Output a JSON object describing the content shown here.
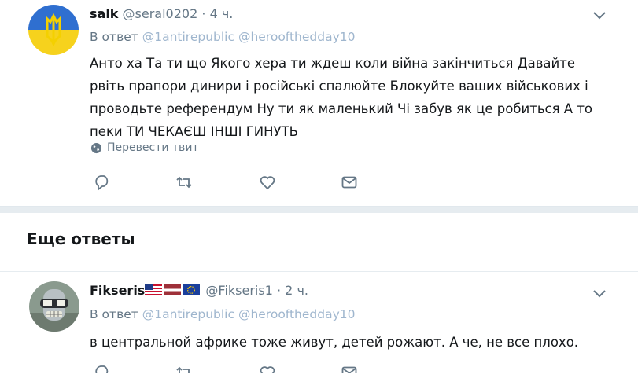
{
  "tweet1": {
    "name": "salk",
    "handle": "@seral0202",
    "separator": "·",
    "time": "4 ч.",
    "reply_prefix": "В ответ",
    "mentions": [
      "@1antirepublic",
      "@heroofthedday10"
    ],
    "text": "Анто ха Та ти що Якого хера ти ждеш коли війна закінчиться Давайте рвіть прапори динири і російські спалюйте Блокуйте ваших військових і проводьте референдум Ну ти як маленький Чі забув як це робиться А то пеки ТИ ЧЕКАЄШ ІНШІ ГИНУТЬ",
    "translate_label": "Перевести твит"
  },
  "section": {
    "title": "Еще ответы"
  },
  "tweet2": {
    "name": "Fikseris",
    "handle": "@Fikseris1",
    "separator": "·",
    "time": "2 ч.",
    "reply_prefix": "В ответ",
    "mentions": [
      "@1antirepublic",
      "@heroofthedday10"
    ],
    "text": "в центральной африке тоже живут, детей рожают. А че, не все плохо."
  },
  "icons": {
    "reply": "reply-icon",
    "retweet": "retweet-icon",
    "like": "heart-icon",
    "dm": "envelope-icon",
    "more": "chevron-down-icon",
    "globe": "globe-icon"
  },
  "colors": {
    "muted": "#657786",
    "mention": "#9fb6ce",
    "divider": "#e6ecf0",
    "flag_blue": "#2f6fd0",
    "flag_yellow": "#f6d21d"
  }
}
